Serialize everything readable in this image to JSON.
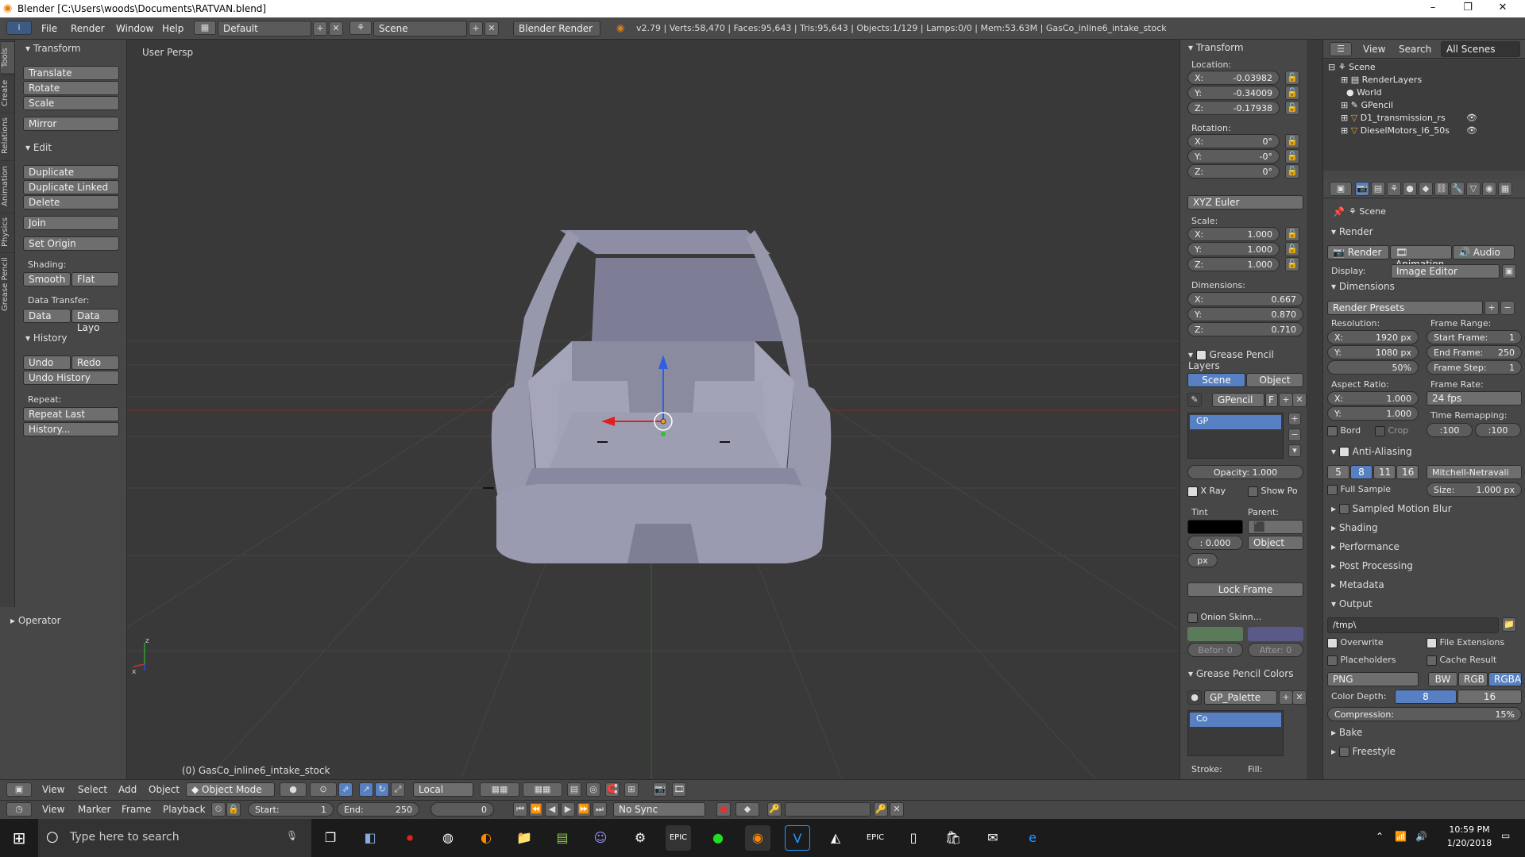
{
  "window": {
    "title": "Blender [C:\\Users\\woods\\Documents\\RATVAN.blend]",
    "min": "–",
    "max": "❐",
    "close": "✕"
  },
  "info": {
    "menus": [
      "File",
      "Render",
      "Window",
      "Help"
    ],
    "screen_layout": "Default",
    "scene": "Scene",
    "engine": "Blender Render",
    "stats": "v2.79 | Verts:58,470 | Faces:95,643 | Tris:95,643 | Objects:1/129 | Lamps:0/0 | Mem:53.63M | GasCo_inline6_intake_stock"
  },
  "tools": {
    "tabs": [
      "Tools",
      "Create",
      "Relations",
      "Animation",
      "Physics",
      "Grease Pencil"
    ],
    "transform_title": "Transform",
    "translate": "Translate",
    "rotate": "Rotate",
    "scale": "Scale",
    "mirror": "Mirror",
    "edit_title": "Edit",
    "duplicate": "Duplicate",
    "duplicate_linked": "Duplicate Linked",
    "delete": "Delete",
    "join": "Join",
    "set_origin": "Set Origin",
    "shading_label": "Shading:",
    "smooth": "Smooth",
    "flat": "Flat",
    "data_transfer_label": "Data Transfer:",
    "data": "Data",
    "data_layo": "Data Layo",
    "history_title": "History",
    "undo": "Undo",
    "redo": "Redo",
    "undo_history": "Undo History",
    "repeat_label": "Repeat:",
    "repeat_last": "Repeat Last",
    "history": "History...",
    "operator_title": "Operator"
  },
  "viewport": {
    "view_name": "User Persp",
    "object_label": "(0) GasCo_inline6_intake_stock"
  },
  "npanel": {
    "transform_title": "Transform",
    "location_label": "Location:",
    "loc_x": "-0.03982",
    "loc_y": "-0.34009",
    "loc_z": "-0.17938",
    "rotation_label": "Rotation:",
    "rot_x": "0°",
    "rot_y": "-0°",
    "rot_z": "0°",
    "rot_mode": "XYZ Euler",
    "scale_label": "Scale:",
    "sc_x": "1.000",
    "sc_y": "1.000",
    "sc_z": "1.000",
    "dimensions_label": "Dimensions:",
    "dim_x": "0.667",
    "dim_y": "0.870",
    "dim_z": "0.710",
    "x": "X:",
    "y": "Y:",
    "z": "Z:",
    "gp_layers_title": "Grease Pencil Layers",
    "scene_tab": "Scene",
    "object_tab": "Object",
    "gpencil": "GPencil",
    "f": "F",
    "gp_layer": "GP",
    "opacity_label": "Opacity:",
    "opacity": "1.000",
    "xray": "X Ray",
    "show_po": "Show Po",
    "tint": "Tint",
    "parent": "Parent:",
    "tint_val": ": 0.000",
    "object_val": "Object",
    "px": "px",
    "lock_frame": "Lock Frame",
    "onion": "Onion Skinn...",
    "before": "Befor: 0",
    "after": "After: 0",
    "gp_colors_title": "Grease Pencil Colors",
    "gp_palette": "GP_Palette",
    "co": "Co",
    "stroke": "Stroke:",
    "fill": "Fill:"
  },
  "outliner": {
    "view": "View",
    "search": "Search",
    "all_scenes": "All Scenes",
    "items": [
      "Scene",
      "RenderLayers",
      "World",
      "GPencil",
      "D1_transmission_rs",
      "DieselMotors_I6_50s"
    ]
  },
  "props": {
    "scene": "Scene",
    "render_title": "Render",
    "render_btn": "Render",
    "animation_btn": "Animation",
    "audio_btn": "Audio",
    "display_label": "Display:",
    "display_val": "Image Editor",
    "dimensions_title": "Dimensions",
    "render_presets": "Render Presets",
    "resolution_label": "Resolution:",
    "res_x": "1920 px",
    "res_y": "1080 px",
    "res_pct": "50%",
    "frame_range_label": "Frame Range:",
    "start_frame": "Start Frame:",
    "start_val": "1",
    "end_frame": "End Frame:",
    "end_val": "250",
    "frame_step": "Frame Step:",
    "step_val": "1",
    "aspect_label": "Aspect Ratio:",
    "asp_x": "1.000",
    "asp_y": "1.000",
    "frame_rate_label": "Frame Rate:",
    "fps": "24 fps",
    "bord": "Bord",
    "crop": "Crop",
    "time_remap": "Time Remapping:",
    "remap_old": ":100",
    "remap_new": ":100",
    "aa_title": "Anti-Aliasing",
    "aa": [
      "5",
      "8",
      "11",
      "16"
    ],
    "filter": "Mitchell-Netravali",
    "full_sample": "Full Sample",
    "size_label": "Size:",
    "size_val": "1.000 px",
    "collapsed": [
      "Sampled Motion Blur",
      "Shading",
      "Performance",
      "Post Processing",
      "Metadata"
    ],
    "output_title": "Output",
    "path": "/tmp\\",
    "overwrite": "Overwrite",
    "file_ext": "File Extensions",
    "placeholders": "Placeholders",
    "cache_result": "Cache Result",
    "format": "PNG",
    "bw": "BW",
    "rgb": "RGB",
    "rgba": "RGBA",
    "color_depth_label": "Color Depth:",
    "depth_8": "8",
    "depth_16": "16",
    "compression": "Compression:",
    "compression_val": "15%",
    "bake": "Bake",
    "freestyle": "Freestyle"
  },
  "header": {
    "view": "View",
    "select": "Select",
    "add": "Add",
    "object": "Object",
    "mode": "Object Mode",
    "orientation": "Local"
  },
  "timeline": {
    "view": "View",
    "marker": "Marker",
    "frame": "Frame",
    "playback": "Playback",
    "start_label": "Start:",
    "start": "1",
    "end_label": "End:",
    "end": "250",
    "current": "0",
    "sync": "No Sync"
  },
  "taskbar": {
    "search_placeholder": "Type here to search",
    "time": "10:59 PM",
    "date": "1/20/2018"
  }
}
